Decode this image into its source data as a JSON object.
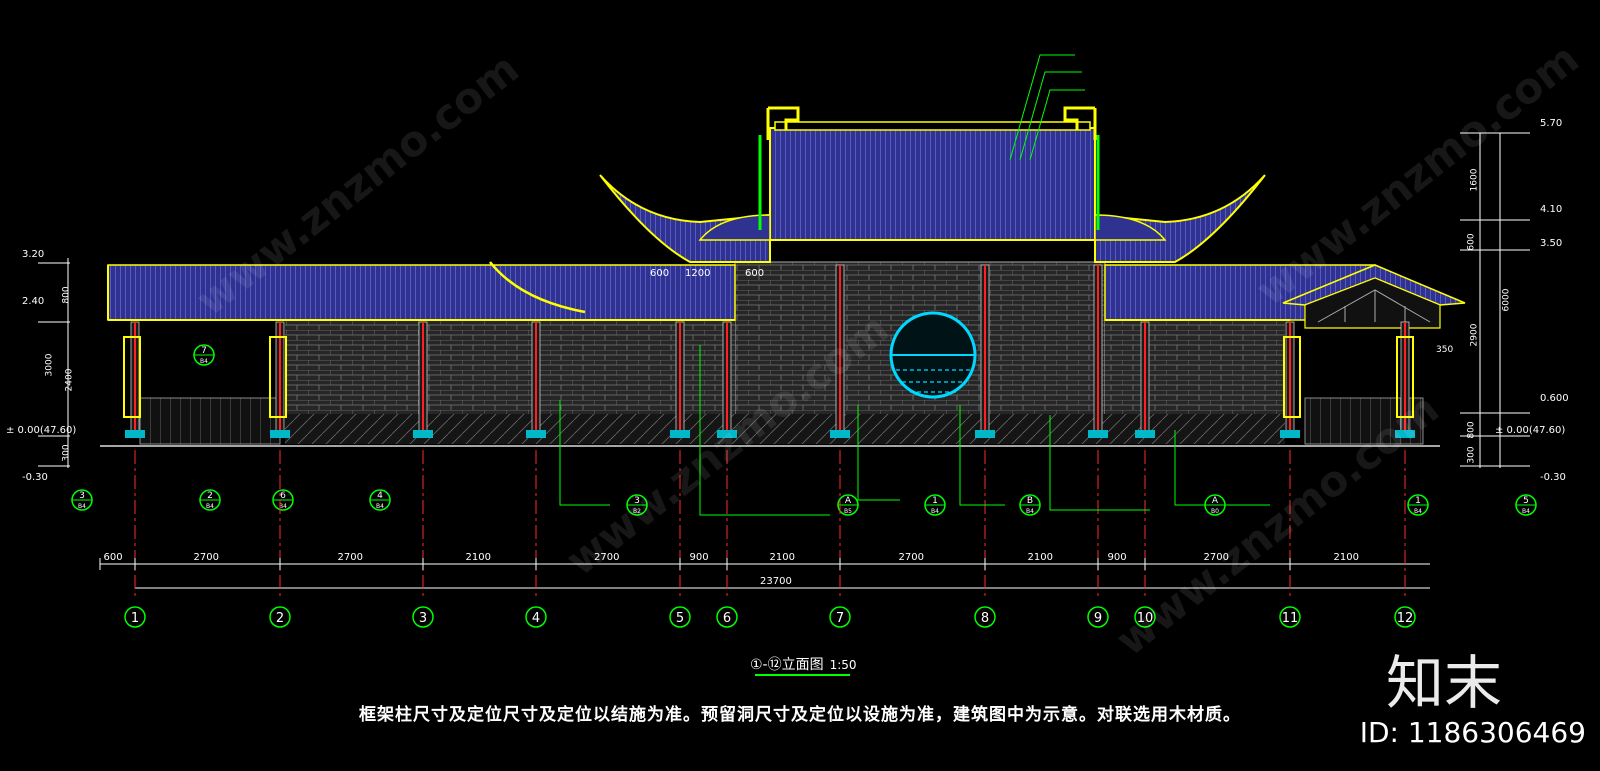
{
  "drawing": {
    "caption": "框架柱尺寸及定位尺寸及定位以结施为准。预留洞尺寸及定位以设施为准，建筑图中为示意。对联选用木材质。",
    "title": "①-⑫立面图",
    "scale": "1:50"
  },
  "brand": "知末",
  "image_id": "ID: 1186306469",
  "watermark": "www.znzmo.com",
  "axes": [
    "1",
    "2",
    "3",
    "4",
    "5",
    "6",
    "7",
    "8",
    "9",
    "10",
    "11",
    "12"
  ],
  "dimensions": {
    "segments": [
      "600",
      "2700",
      "2700",
      "2100",
      "2700",
      "900",
      "2100",
      "2700",
      "2100",
      "900",
      "2700",
      "2100"
    ],
    "total": "23700",
    "roof_gap": [
      "600",
      "1200",
      "600"
    ]
  },
  "left_levels": [
    "3.20",
    "2.40",
    "± 0.00(47.60)",
    "-0.30"
  ],
  "left_dims": [
    "800",
    "2400",
    "3000",
    "300"
  ],
  "right_levels": [
    "5.70",
    "4.10",
    "3.50",
    "0.600",
    "± 0.00(47.60)",
    "-0.30"
  ],
  "right_dims": [
    "1600",
    "600",
    "6000",
    "2900",
    "800",
    "300"
  ],
  "right_small": "350",
  "callouts": [
    {
      "num": "3",
      "ref": "B4"
    },
    {
      "num": "2",
      "ref": "B4"
    },
    {
      "num": "6",
      "ref": "B4"
    },
    {
      "num": "4",
      "ref": "B4"
    },
    {
      "num": "3",
      "ref": "B2"
    },
    {
      "num": "A",
      "ref": "B5"
    },
    {
      "num": "1",
      "ref": "B4"
    },
    {
      "num": "B",
      "ref": "B4"
    },
    {
      "num": "A",
      "ref": "B0"
    },
    {
      "num": "1",
      "ref": "B4"
    },
    {
      "num": "5",
      "ref": "B4"
    },
    {
      "num": "7",
      "ref": "B4"
    }
  ],
  "colors": {
    "roof": "#3b3f9a",
    "brick": "#3a3a3a",
    "frame": "#ffff00",
    "green": "#00ff00",
    "cyan": "#00d8ff",
    "red": "#ff2020"
  }
}
